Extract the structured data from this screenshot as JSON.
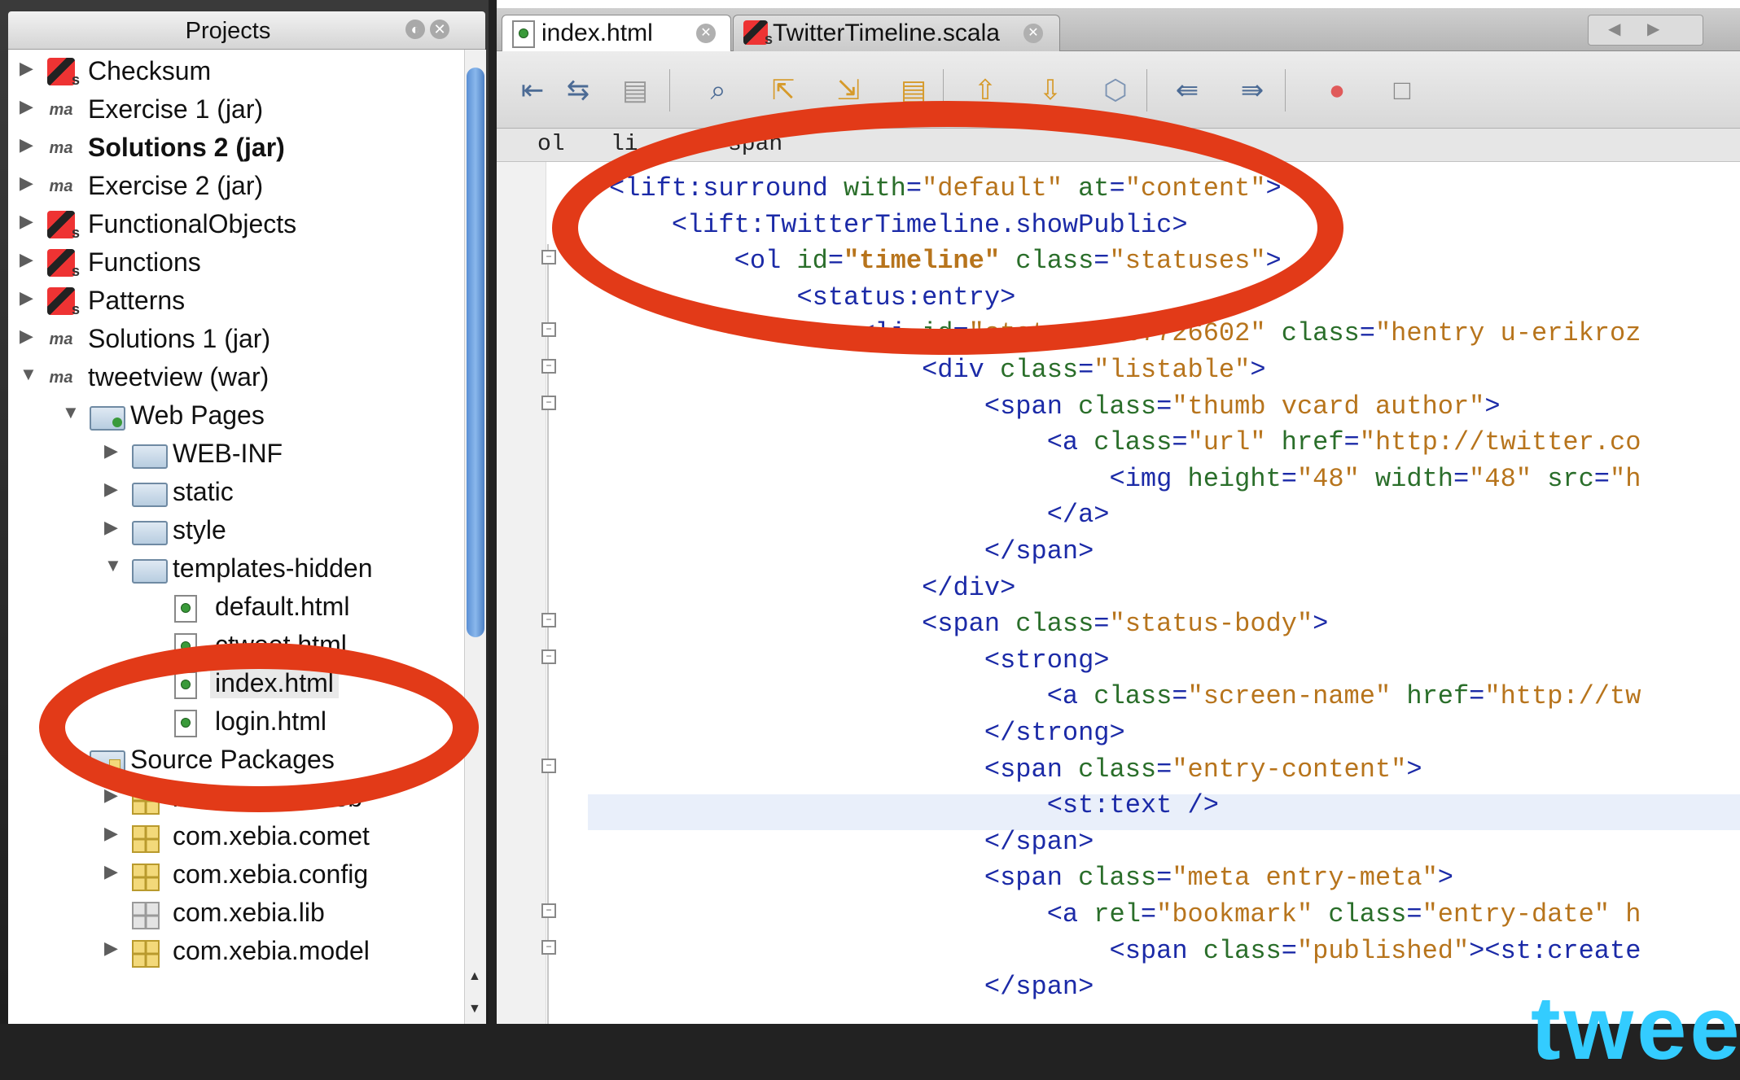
{
  "projects_panel": {
    "title": "Projects",
    "items": [
      {
        "label": "Checksum",
        "icon": "scala-project-icon",
        "expander": "▶",
        "bold": false
      },
      {
        "label": "Exercise 1 (jar)",
        "icon": "maven-project-icon",
        "expander": "▶",
        "bold": false
      },
      {
        "label": "Solutions 2 (jar)",
        "icon": "maven-project-icon",
        "expander": "▶",
        "bold": true
      },
      {
        "label": "Exercise 2 (jar)",
        "icon": "maven-project-icon",
        "expander": "▶",
        "bold": false
      },
      {
        "label": "FunctionalObjects",
        "icon": "scala-project-icon",
        "expander": "▶",
        "bold": false
      },
      {
        "label": "Functions",
        "icon": "scala-project-icon",
        "expander": "▶",
        "bold": false
      },
      {
        "label": "Patterns",
        "icon": "scala-project-icon",
        "expander": "▶",
        "bold": false
      },
      {
        "label": "Solutions 1 (jar)",
        "icon": "maven-project-icon",
        "expander": "▶",
        "bold": false
      },
      {
        "label": "tweetview (war)",
        "icon": "maven-project-icon",
        "expander": "▼",
        "bold": false
      },
      {
        "label": "Web Pages",
        "icon": "web-pages-folder-icon",
        "expander": "▼",
        "bold": false
      },
      {
        "label": "WEB-INF",
        "icon": "folder-icon",
        "expander": "▶",
        "bold": false
      },
      {
        "label": "static",
        "icon": "folder-icon",
        "expander": "▶",
        "bold": false
      },
      {
        "label": "style",
        "icon": "folder-icon",
        "expander": "▶",
        "bold": false
      },
      {
        "label": "templates-hidden",
        "icon": "folder-icon",
        "expander": "▼",
        "bold": false
      },
      {
        "label": "default.html",
        "icon": "html-file-icon",
        "expander": "",
        "bold": false
      },
      {
        "label": "ctweet.html",
        "icon": "html-file-icon",
        "expander": "",
        "bold": false
      },
      {
        "label": "index.html",
        "icon": "html-file-icon",
        "expander": "",
        "bold": false,
        "selected": true
      },
      {
        "label": "login.html",
        "icon": "html-file-icon",
        "expander": "",
        "bold": false
      },
      {
        "label": "Source Packages",
        "icon": "source-packages-icon",
        "expander": "▼",
        "bold": false
      },
      {
        "label": "bootstrap.liftweb",
        "icon": "package-icon",
        "expander": "▶",
        "bold": false
      },
      {
        "label": "com.xebia.comet",
        "icon": "package-icon",
        "expander": "▶",
        "bold": false
      },
      {
        "label": "com.xebia.config",
        "icon": "package-icon",
        "expander": "▶",
        "bold": false
      },
      {
        "label": "com.xebia.lib",
        "icon": "empty-package-icon",
        "expander": "",
        "bold": false
      },
      {
        "label": "com.xebia.model",
        "icon": "package-icon",
        "expander": "▶",
        "bold": false
      }
    ]
  },
  "editor": {
    "tabs": [
      {
        "label": "index.html",
        "active": true
      },
      {
        "label": "TwitterTimeline.scala",
        "active": false
      }
    ],
    "breadcrumb": [
      "ol",
      "li",
      "span"
    ],
    "toolbar_icons": [
      "back-icon",
      "history-icon",
      "forward-icon",
      "find-icon",
      "find-previous-icon",
      "find-next-icon",
      "toggle-highlight-icon",
      "previous-bookmark-icon",
      "next-bookmark-icon",
      "toggle-bookmark-icon",
      "shift-left-icon",
      "shift-right-icon",
      "record-macro-icon",
      "stop-macro-icon"
    ],
    "code_lines": [
      "<lift:surround with=\"default\" at=\"content\">",
      "    <lift:TwitterTimeline.showPublic>",
      "        <ol id=\"timeline\" class=\"statuses\">",
      "            <status:entry>",
      "                <li id=\"status_3367726602\" class=\"hentry u-erikroz",
      "                    <div class=\"listable\">",
      "                        <span class=\"thumb vcard author\">",
      "                            <a class=\"url\" href=\"http://twitter.co",
      "                                <img height=\"48\" width=\"48\" src=\"h",
      "                            </a>",
      "                        </span>",
      "                    </div>",
      "                    <span class=\"status-body\">",
      "                        <strong>",
      "                            <a class=\"screen-name\" href=\"http://tw",
      "                        </strong>",
      "                        <span class=\"entry-content\">",
      "                            <st:text />",
      "                        </span>",
      "                        <span class=\"meta entry-meta\">",
      "                            <a rel=\"bookmark\" class=\"entry-date\" h",
      "                                <span class=\"published\"><st:create",
      "                        </span>"
    ]
  },
  "watermark": "twee",
  "colors": {
    "annotation_red": "#e23a18",
    "tag_blue": "#1b2aa7",
    "attr_green": "#2a6e2a",
    "value_orange": "#b7741c",
    "scrollbar_blue": "#6a9fe0",
    "current_line": "#e9effa"
  }
}
